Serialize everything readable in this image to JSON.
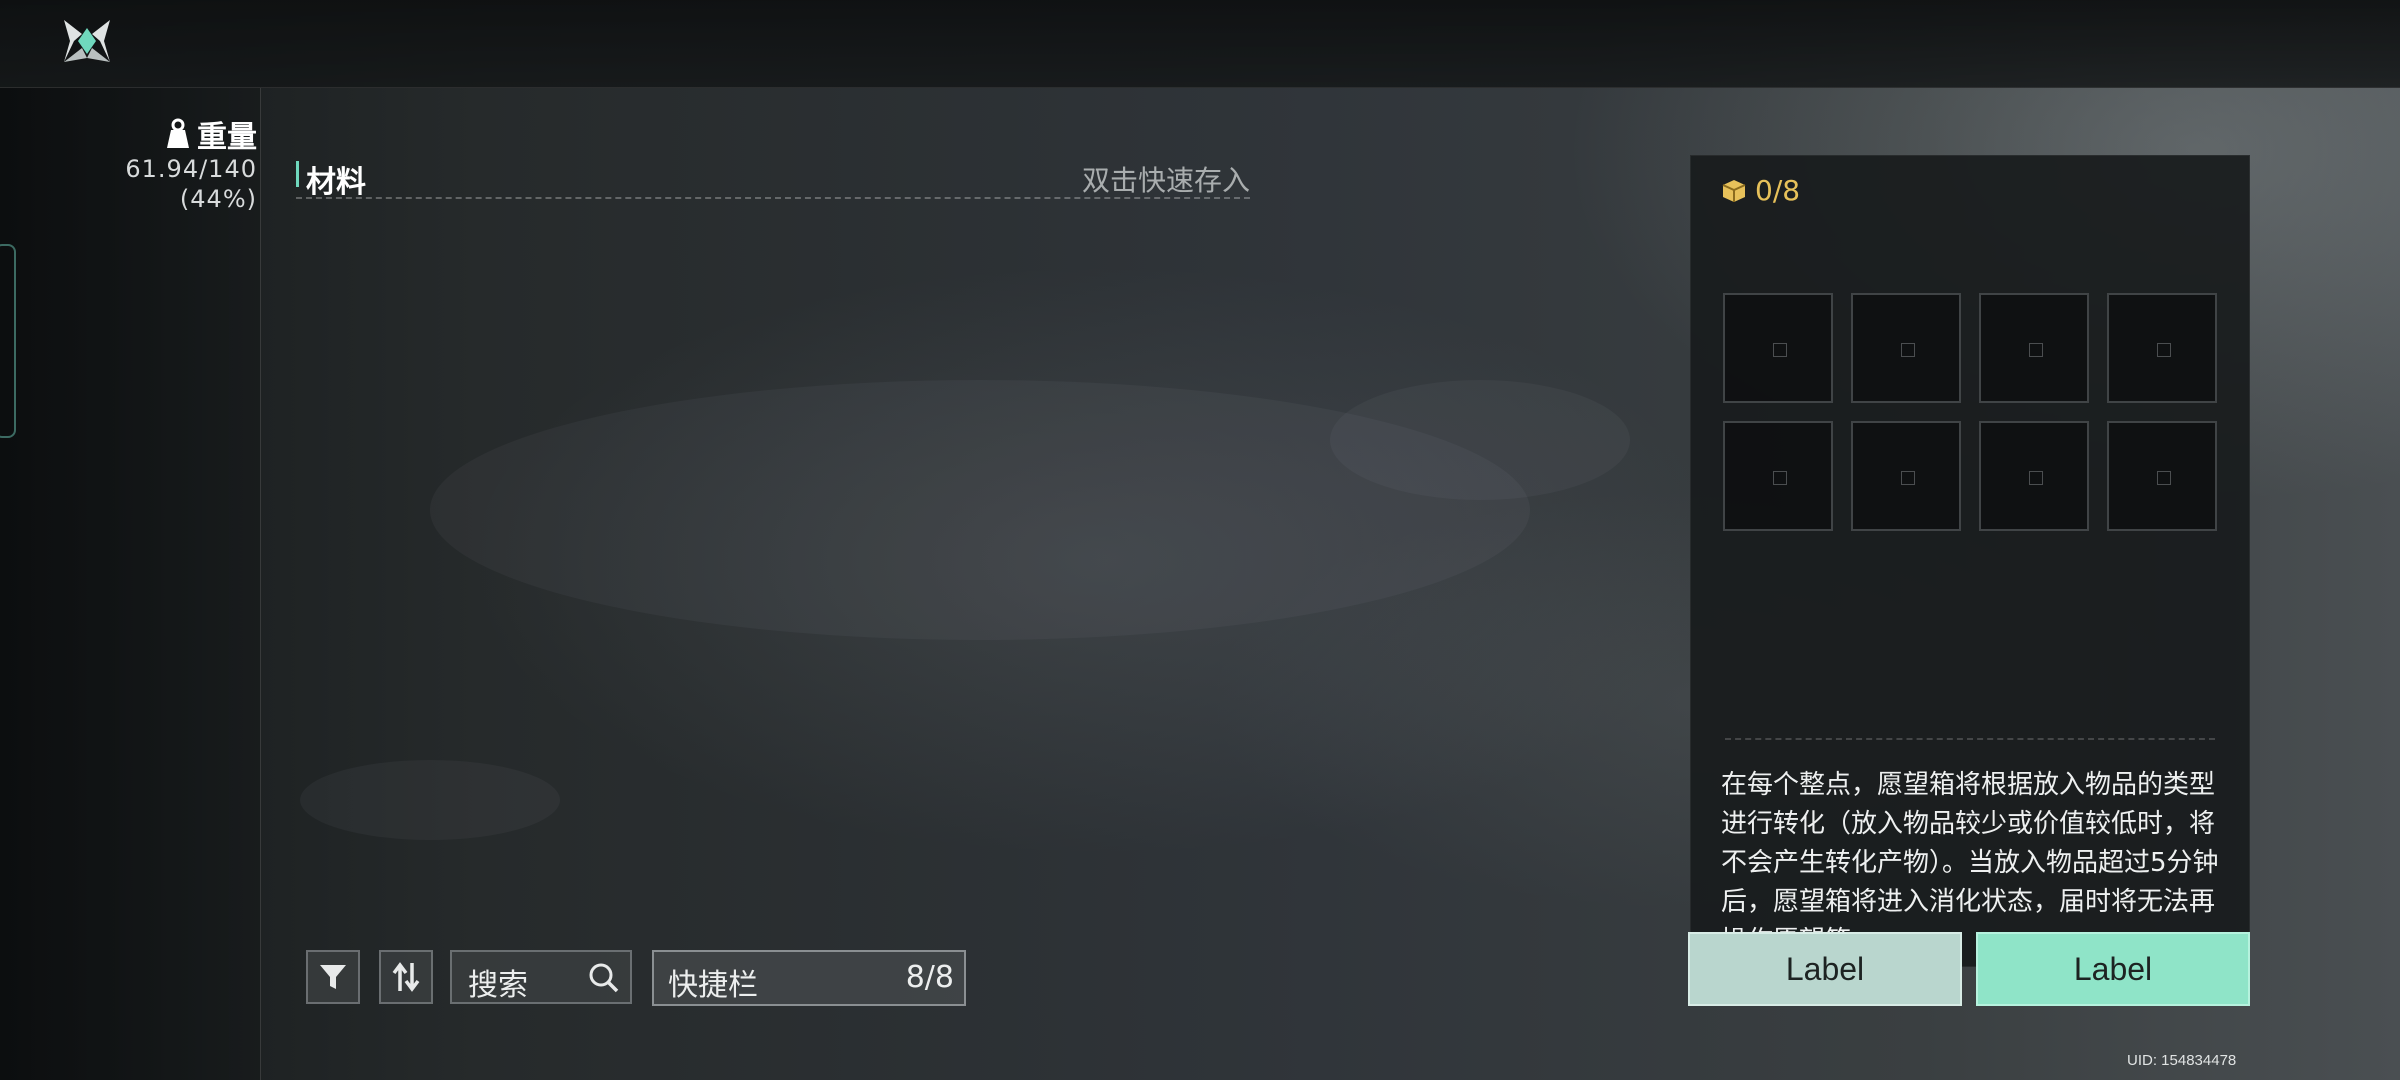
{
  "weight": {
    "title": "重量",
    "value": "61.94/140",
    "percent": "(44%)",
    "icon": "weight-icon"
  },
  "inventory": {
    "section_title": "材料",
    "quick_store_hint": "双击快速存入"
  },
  "toolbar": {
    "filter_icon": "filter-icon",
    "sort_icon": "sort-icon",
    "search_label": "搜索",
    "hotbar_label": "快捷栏",
    "hotbar_count": "8/8"
  },
  "wish_box": {
    "icon": "box-icon",
    "count": "0/8",
    "slot_count": 8,
    "description": "在每个整点，愿望箱将根据放入物品的类型进行转化（放入物品较少或价值较低时，将不会产生转化产物）。当放入物品超过5分钟后，愿望箱将进入消化状态，届时将无法再操作愿望箱。"
  },
  "buttons": {
    "left_label": "Label",
    "right_label": "Label"
  },
  "footer": {
    "uid": "UID: 154834478"
  },
  "colors": {
    "accent": "#6fd8bd",
    "box_count": "#e7c15a",
    "button_left": "#b9d6ce",
    "button_right": "#8fe4c8"
  }
}
